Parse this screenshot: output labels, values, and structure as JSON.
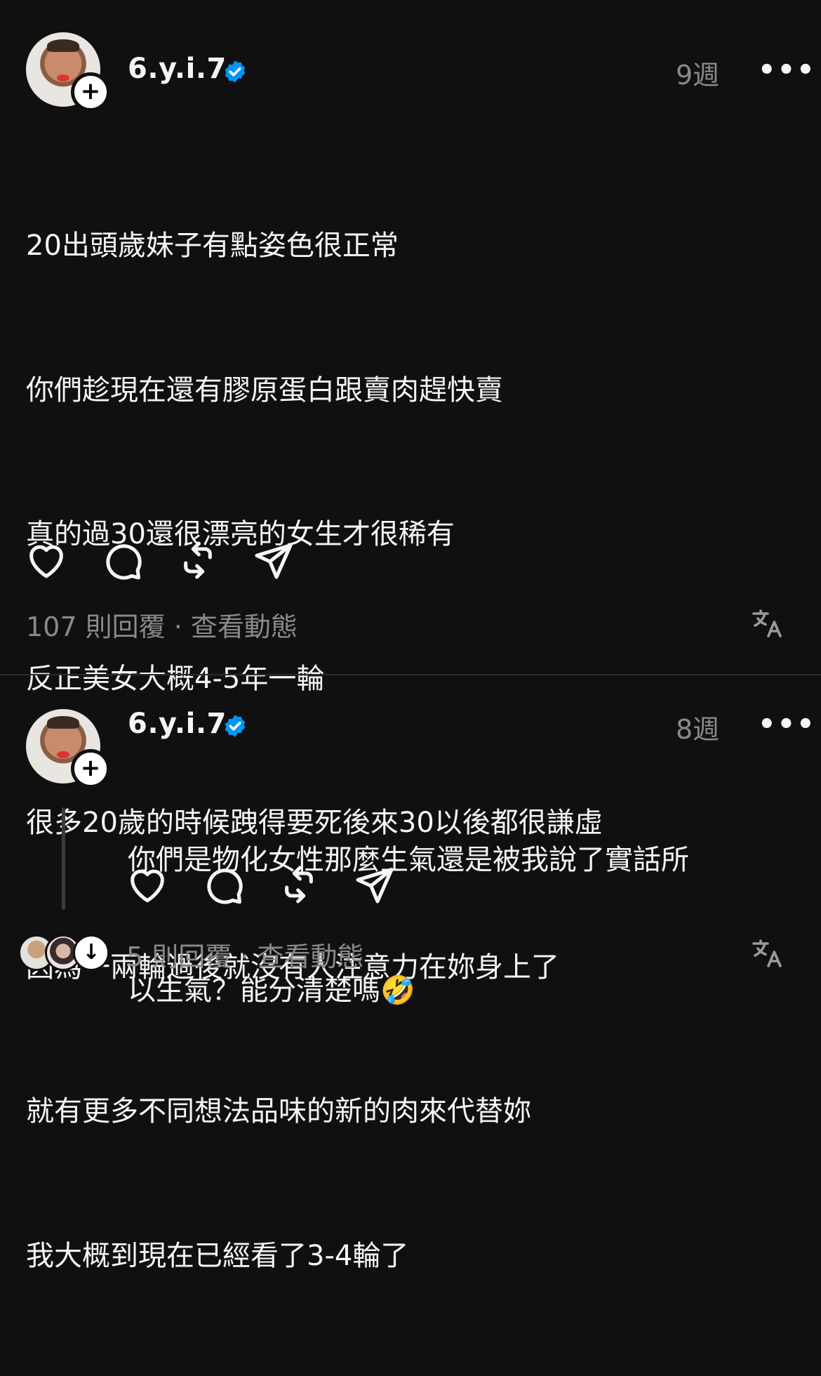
{
  "post": {
    "username": "6.y.i.7",
    "time": "9週",
    "more_label": "•••",
    "follow_label": "+",
    "lines": [
      "20出頭歲妹子有點姿色很正常",
      "你們趁現在還有膠原蛋白跟賣肉趕快賣",
      "真的過30還很漂亮的女生才很稀有",
      "反正美女大概4-5年一輪",
      "很多20歲的時候跩得要死後來30以後都很謙虛",
      "因為一兩輪過後就沒有人注意力在妳身上了",
      "就有更多不同想法品味的新的肉來代替妳",
      "我大概到現在已經看了3-4輪了"
    ],
    "replies_text": "107 則回覆 · 查看動態"
  },
  "reply": {
    "username": "6.y.i.7",
    "time": "8週",
    "more_label": "•••",
    "follow_label": "+",
    "lines": [
      "你們是物化女性那麼生氣還是被我說了實話所",
      "以生氣？能分清楚嗎🤣"
    ],
    "replies_text": "5 則回覆 · 查看動態",
    "expand_icon_label": "↓"
  },
  "colors": {
    "background": "#101010",
    "text": "#f3f5f7",
    "muted": "#8a8a8a",
    "verified": "#0095f6"
  }
}
